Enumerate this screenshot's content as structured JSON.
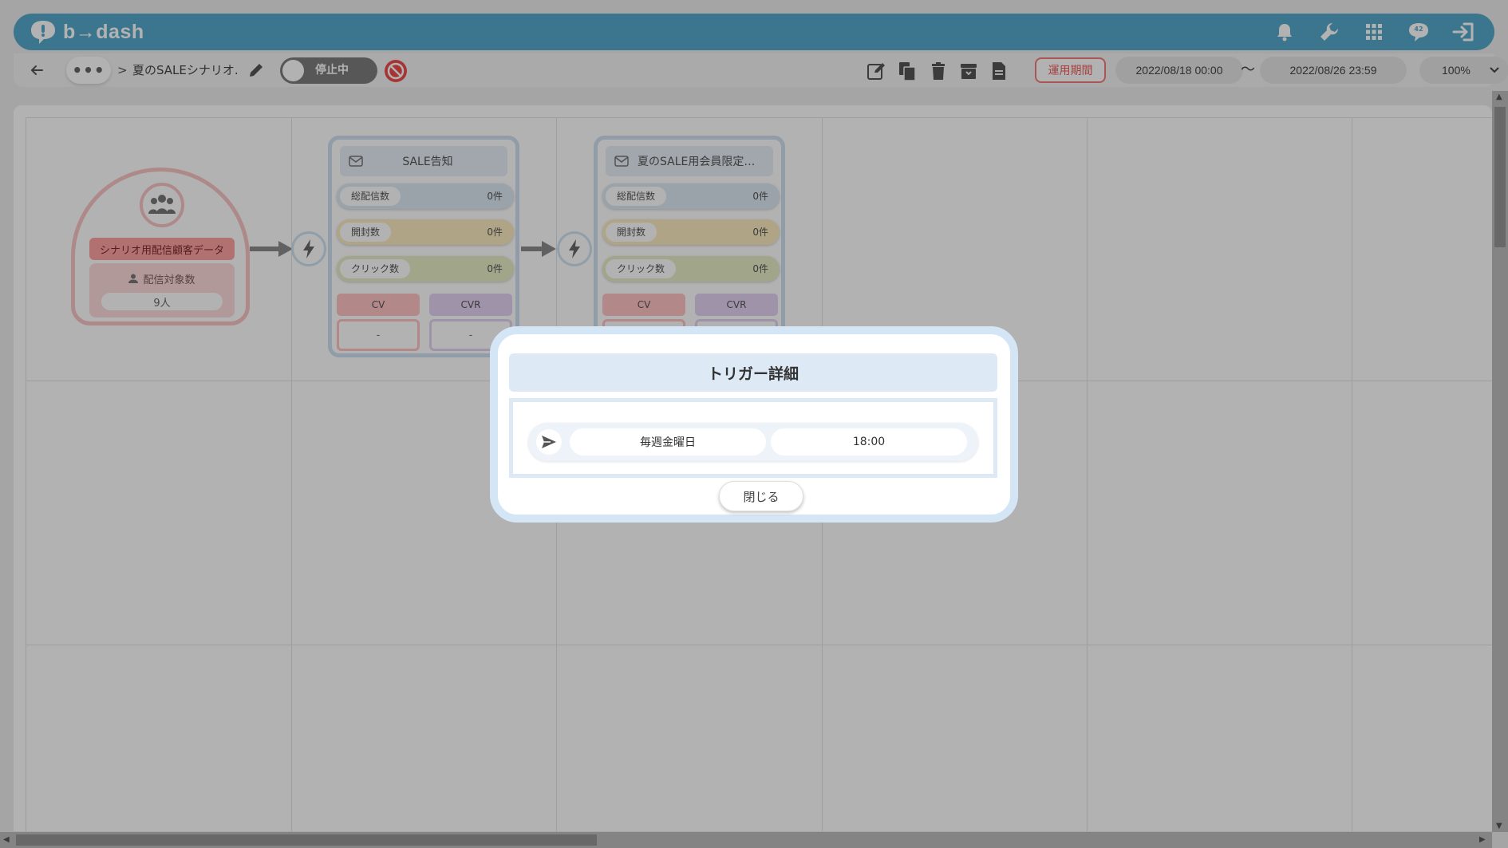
{
  "app": {
    "logo_text": "b→dash"
  },
  "header": {
    "icons": [
      "bell-icon",
      "wrench-icon",
      "apps-grid-icon",
      "chat-icon",
      "logout-icon"
    ],
    "chat_badge": "42"
  },
  "toolbar": {
    "more_label": "•••",
    "breadcrumb_separator": ">",
    "scenario_name": "夏のSALEシナリオ.",
    "status_toggle_label": "停止中",
    "tools": [
      "edit-memo-icon",
      "copy-icon",
      "delete-icon",
      "archive-icon",
      "document-icon"
    ],
    "period_label": "運用期間",
    "start_date": "2022/08/18 00:00",
    "tilde": "〜",
    "end_date": "2022/08/26 23:59",
    "zoom": "100%"
  },
  "canvas": {
    "customer_node": {
      "title": "シナリオ用配信顧客データ",
      "count_label": "配信対象数",
      "count_value": "9人"
    },
    "mail_nodes": [
      {
        "title": "SALE告知",
        "stats": [
          {
            "label": "総配信数",
            "value": "0件"
          },
          {
            "label": "開封数",
            "value": "0件"
          },
          {
            "label": "クリック数",
            "value": "0件"
          }
        ],
        "cv_label": "CV",
        "cvr_label": "CVR",
        "cv_value": "-",
        "cvr_value": "-"
      },
      {
        "title": "夏のSALE用会員限定ク…",
        "stats": [
          {
            "label": "総配信数",
            "value": "0件"
          },
          {
            "label": "開封数",
            "value": "0件"
          },
          {
            "label": "クリック数",
            "value": "0件"
          }
        ],
        "cv_label": "CV",
        "cvr_label": "CVR",
        "cv_value": "",
        "cvr_value": ""
      }
    ]
  },
  "modal": {
    "title": "トリガー詳細",
    "schedule_day": "毎週金曜日",
    "schedule_time": "18:00",
    "close_label": "閉じる"
  },
  "colors": {
    "header": "#56a8cc",
    "toggle_off": "#7d7d7d",
    "period_accent": "#f05b5b",
    "customer_accent": "#ffa2a2",
    "mail_border": "#cfe0ef",
    "modal_border": "#d4e6f6"
  }
}
